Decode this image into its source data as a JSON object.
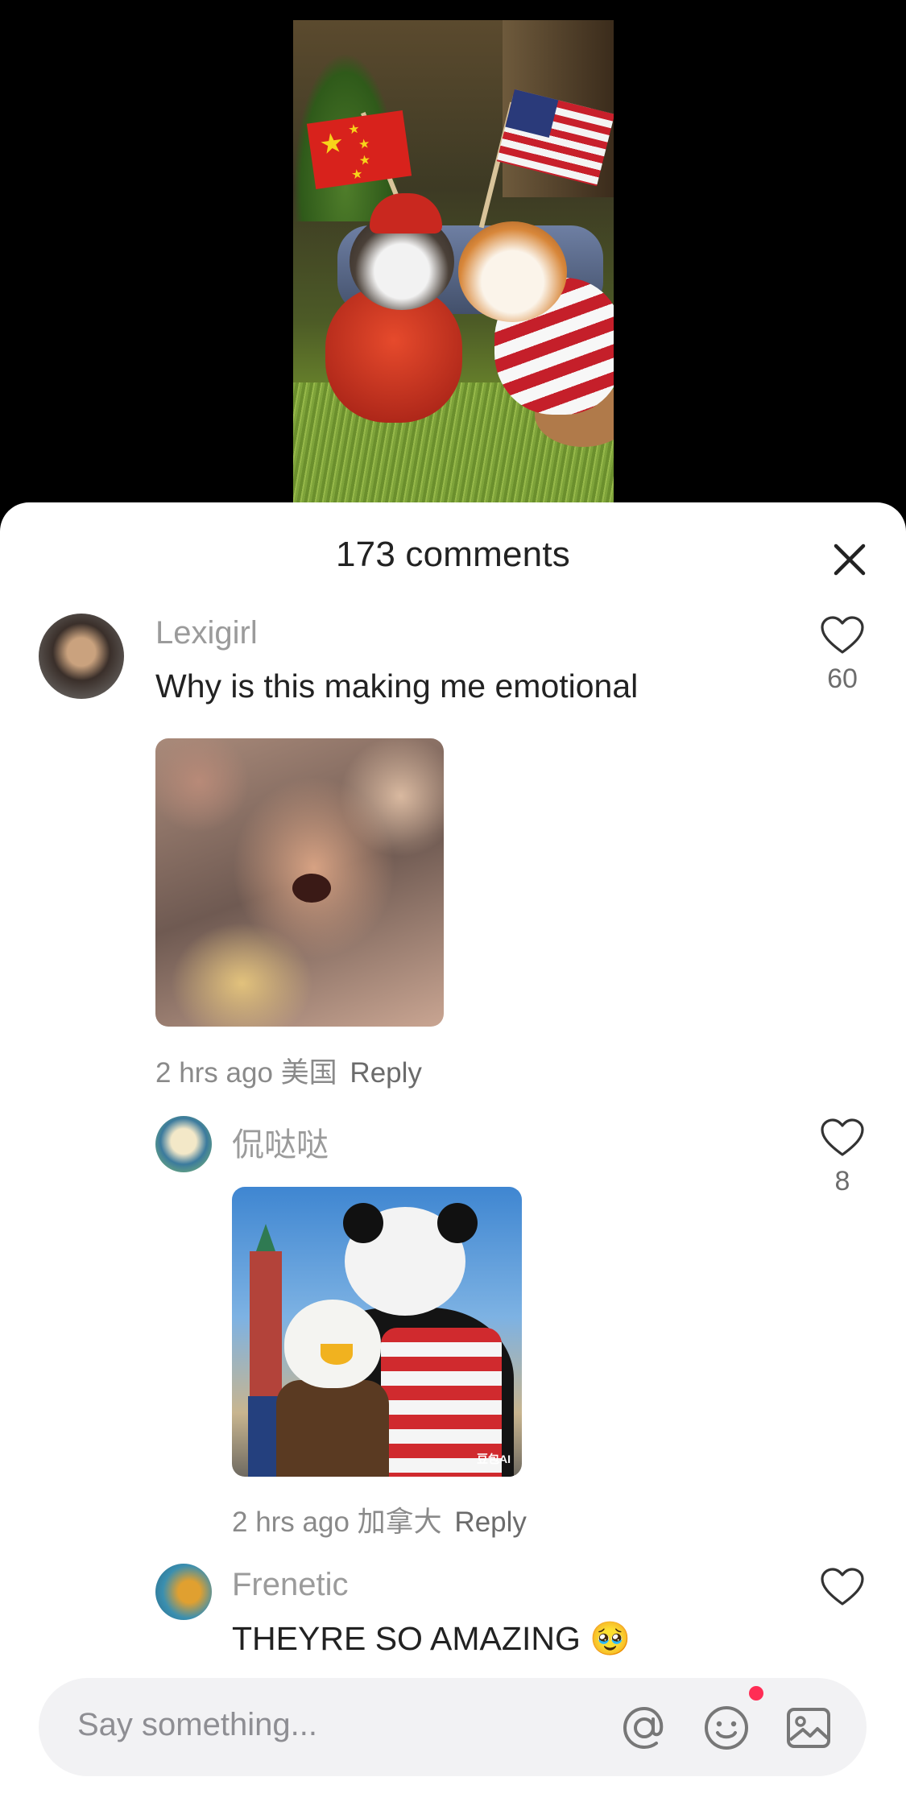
{
  "video": {
    "description_icon": "video-thumbnail"
  },
  "sheet": {
    "title": "173 comments",
    "close_icon": "close-icon"
  },
  "comments": [
    {
      "username": "Lexigirl",
      "text": "Why is this making me emotional",
      "time": "2 hrs ago",
      "location": "美国",
      "reply_label": "Reply",
      "likes": "60"
    },
    {
      "username": "侃哒哒",
      "text": "",
      "time": "2 hrs ago",
      "location": "加拿大",
      "reply_label": "Reply",
      "likes": "8",
      "image_watermark": "豆包AI"
    },
    {
      "username": "Frenetic",
      "text": "THEYRE SO AMAZING",
      "emoji": "🥹",
      "likes": ""
    }
  ],
  "input": {
    "placeholder": "Say something...",
    "icons": [
      "at-icon",
      "emoji-icon",
      "image-icon"
    ]
  },
  "colors": {
    "sheet_bg": "#ffffff",
    "muted": "#9b9b9b",
    "badge": "#ff2d55"
  }
}
